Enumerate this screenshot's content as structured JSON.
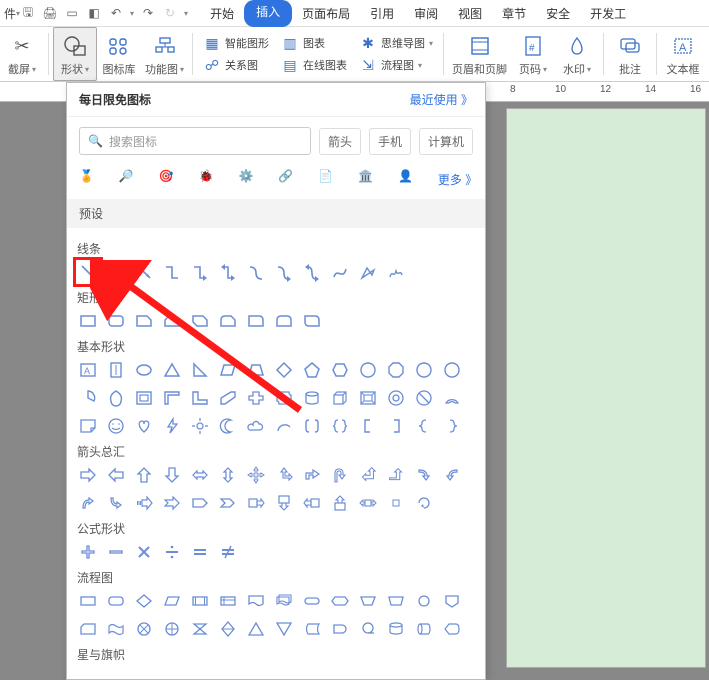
{
  "qat_title_prefix": "件",
  "tabs": {
    "start": "开始",
    "insert": "插入",
    "page_layout": "页面布局",
    "reference": "引用",
    "review": "审阅",
    "view": "视图",
    "chapter": "章节",
    "security": "安全",
    "dev": "开发工"
  },
  "ribbon": {
    "screenshot": "截屏",
    "shapes": "形状",
    "icon_lib": "图标库",
    "func_fig": "功能图",
    "smart_art": "智能图形",
    "chart": "图表",
    "relation": "关系图",
    "online_chart": "在线图表",
    "mindmap": "思维导图",
    "flowchart": "流程图",
    "header_footer": "页眉和页脚",
    "page_num": "页码",
    "watermark": "水印",
    "comment": "批注",
    "textbox": "文本框"
  },
  "panel": {
    "title": "每日限免图标",
    "recent": "最近使用 》",
    "search_placeholder": "搜索图标",
    "tag_arrow": "箭头",
    "tag_phone": "手机",
    "tag_computer": "计算机",
    "more": "更多 》",
    "preset": "预设",
    "sections": {
      "lines": "线条",
      "rect": "矩形",
      "basic": "基本形状",
      "arrows": "箭头总汇",
      "formula": "公式形状",
      "flow": "流程图",
      "stars": "星与旗帜"
    },
    "cat_icons": [
      "medal",
      "globe",
      "target",
      "bug",
      "gear",
      "network",
      "page",
      "building",
      "head"
    ]
  },
  "ruler_marks": [
    "8",
    "10",
    "12",
    "14",
    "16"
  ],
  "chart_data": null
}
